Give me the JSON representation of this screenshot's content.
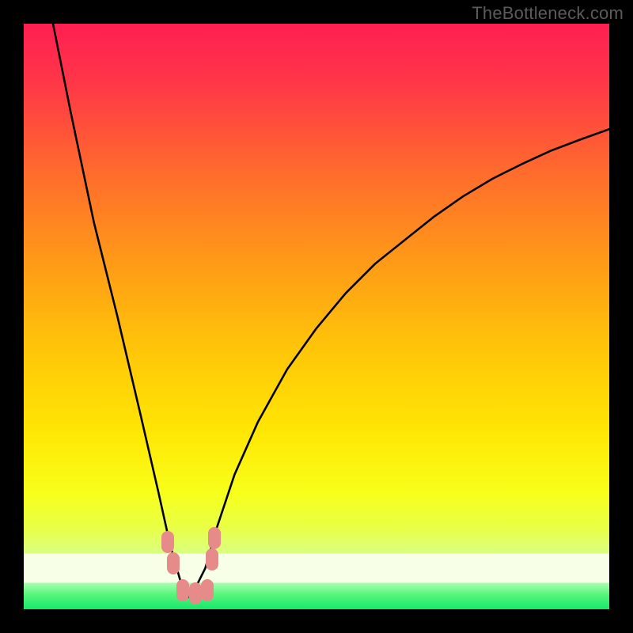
{
  "watermark": "TheBottleneck.com",
  "colors": {
    "frame_bg": "#000000",
    "curve": "#000000",
    "marker": "#e78a8a",
    "gradient_stops": [
      {
        "offset": 0.0,
        "color": "#ff1f52"
      },
      {
        "offset": 0.1,
        "color": "#ff3648"
      },
      {
        "offset": 0.25,
        "color": "#ff6a2d"
      },
      {
        "offset": 0.4,
        "color": "#ff9818"
      },
      {
        "offset": 0.55,
        "color": "#ffc409"
      },
      {
        "offset": 0.7,
        "color": "#ffe704"
      },
      {
        "offset": 0.8,
        "color": "#f7ff1a"
      },
      {
        "offset": 0.86,
        "color": "#e9ff45"
      },
      {
        "offset": 0.905,
        "color": "#d9ff81"
      },
      {
        "offset": 0.905,
        "color": "#f7ffe6"
      },
      {
        "offset": 0.955,
        "color": "#f7ffe6"
      },
      {
        "offset": 0.955,
        "color": "#a8ffb0"
      },
      {
        "offset": 0.975,
        "color": "#57f57a"
      },
      {
        "offset": 1.0,
        "color": "#14e86f"
      }
    ]
  },
  "chart_data": {
    "type": "line",
    "title": "",
    "xlabel": "",
    "ylabel": "",
    "xlim": [
      0,
      100
    ],
    "ylim": [
      0,
      100
    ],
    "grid": false,
    "legend": false,
    "note": "V-shaped bottleneck curve; minimum near x≈28; values estimated from pixels.",
    "series": [
      {
        "name": "curve",
        "x": [
          5,
          8,
          12,
          16,
          20,
          23,
          25,
          27,
          28,
          29,
          31,
          33,
          36,
          40,
          45,
          50,
          55,
          60,
          65,
          70,
          75,
          80,
          85,
          90,
          95,
          100
        ],
        "y": [
          100,
          85,
          66,
          50,
          33,
          20,
          11,
          4,
          2,
          3,
          7,
          14,
          23,
          32,
          41,
          48,
          54,
          59,
          63,
          67,
          70.5,
          73.5,
          76,
          78.3,
          80.2,
          82
        ]
      }
    ],
    "markers": {
      "name": "highlight-cluster",
      "color_key": "marker",
      "xy": [
        [
          24.6,
          11.5
        ],
        [
          25.5,
          7.8
        ],
        [
          27.1,
          3.2
        ],
        [
          29.3,
          2.7
        ],
        [
          31.4,
          3.2
        ],
        [
          32.2,
          8.5
        ],
        [
          32.6,
          12.2
        ]
      ]
    }
  }
}
